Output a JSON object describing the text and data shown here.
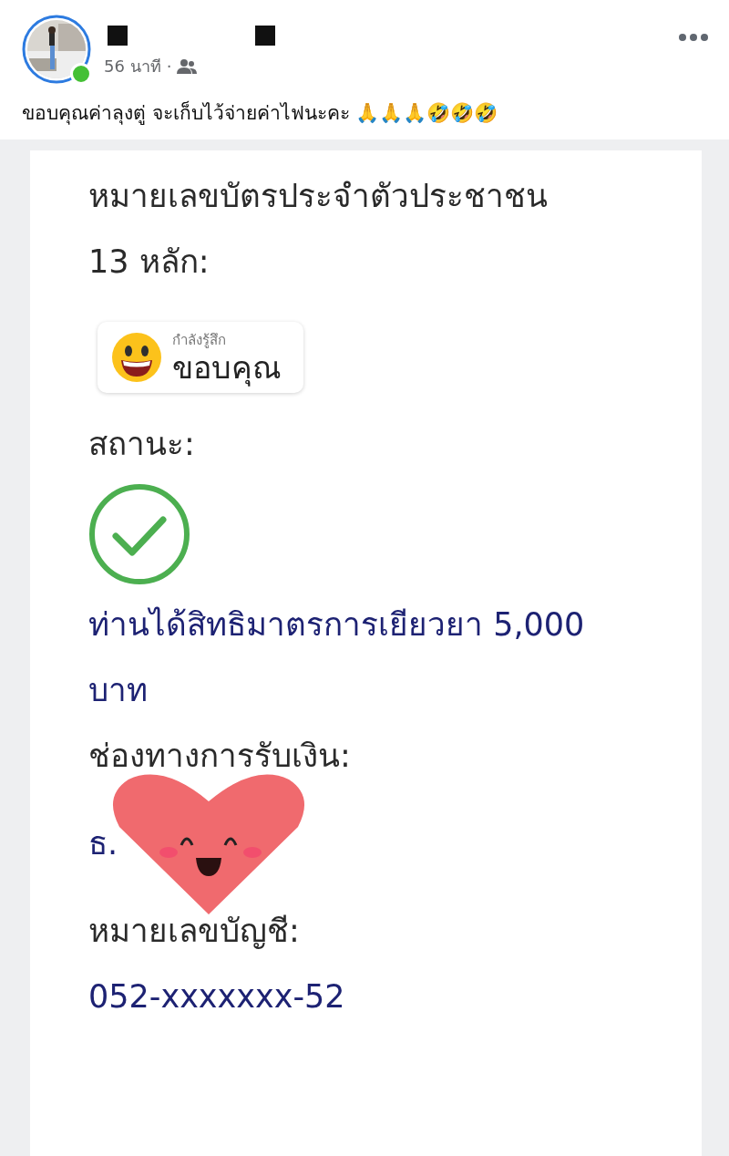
{
  "post": {
    "author_online": true,
    "time": "56 นาที",
    "separator": "·",
    "caption": "ขอบคุณค่าลุงตู่ จะเก็บไว้จ่ายค่าไฟนะคะ 🙏🙏🙏🤣🤣🤣"
  },
  "feeling_sticker": {
    "label": "กำลังรู้สึก",
    "feeling": "ขอบคุณ"
  },
  "document": {
    "lines": [
      {
        "kind": "label",
        "text": "หมายเลขบัตรประจำตัวประชาชน"
      },
      {
        "kind": "label",
        "text": "13 หลัก:"
      },
      {
        "kind": "spacer_sticker"
      },
      {
        "kind": "label",
        "text": "สถานะ:"
      },
      {
        "kind": "check"
      },
      {
        "kind": "value",
        "text": "ท่านได้สิทธิมาตรการเยียวยา 5,000"
      },
      {
        "kind": "value",
        "text": "บาท"
      },
      {
        "kind": "label",
        "text": "ช่องทางการรับเงิน:"
      },
      {
        "kind": "value_heart",
        "text": "ธ."
      },
      {
        "kind": "label",
        "text": "หมายเลขบัญชี:"
      },
      {
        "kind": "value",
        "text": "052-xxxxxxx-52"
      }
    ]
  }
}
